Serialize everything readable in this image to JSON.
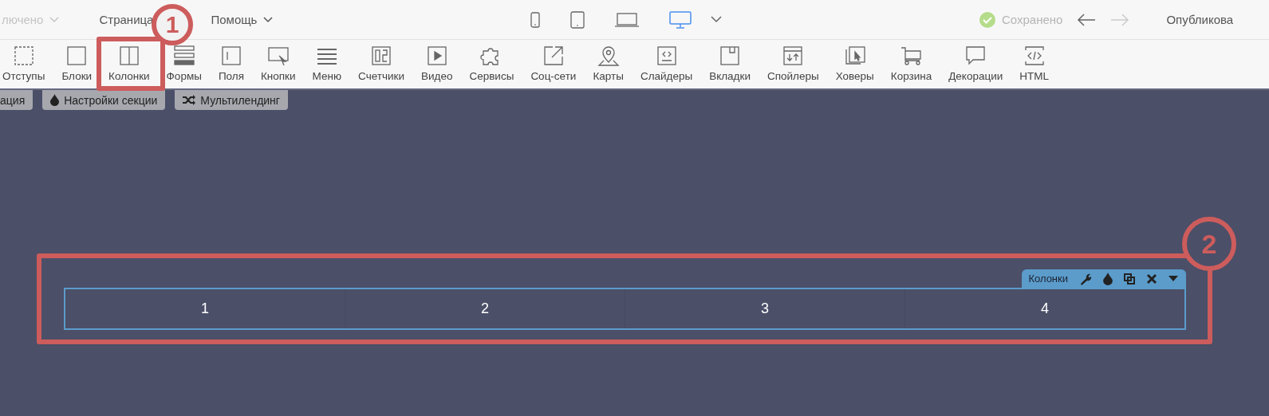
{
  "top_bar": {
    "status_menu": {
      "label": "лючено",
      "disabled": true
    },
    "menus": [
      {
        "label": "Страница"
      },
      {
        "label": "Помощь"
      }
    ],
    "devices": [
      {
        "kind": "phone",
        "selected": false
      },
      {
        "kind": "tablet",
        "selected": false
      },
      {
        "kind": "laptop",
        "selected": false
      },
      {
        "kind": "desktop",
        "selected": true
      }
    ],
    "save_status": "Сохранено",
    "undo_disabled": false,
    "redo_disabled": true,
    "publish": "Опубликова"
  },
  "toolbar": [
    {
      "label": "Отступы",
      "kind": "padding"
    },
    {
      "label": "Блоки",
      "kind": "block"
    },
    {
      "label": "Колонки",
      "kind": "columns"
    },
    {
      "label": "Формы",
      "kind": "forms"
    },
    {
      "label": "Поля",
      "kind": "field"
    },
    {
      "label": "Кнопки",
      "kind": "button"
    },
    {
      "label": "Меню",
      "kind": "menu"
    },
    {
      "label": "Счетчики",
      "kind": "counter"
    },
    {
      "label": "Видео",
      "kind": "video"
    },
    {
      "label": "Сервисы",
      "kind": "puzzle"
    },
    {
      "label": "Соц-сети",
      "kind": "share"
    },
    {
      "label": "Карты",
      "kind": "map"
    },
    {
      "label": "Слайдеры",
      "kind": "slider"
    },
    {
      "label": "Вкладки",
      "kind": "tabs"
    },
    {
      "label": "Спойлеры",
      "kind": "spoiler"
    },
    {
      "label": "Ховеры",
      "kind": "hover"
    },
    {
      "label": "Корзина",
      "kind": "cart"
    },
    {
      "label": "Декорации",
      "kind": "speech"
    },
    {
      "label": "HTML",
      "kind": "code"
    }
  ],
  "section_tabs": [
    {
      "label": "ация",
      "kind": "plain"
    },
    {
      "label": "Настройки секции",
      "kind": "drop"
    },
    {
      "label": "Мультилендинг",
      "kind": "shuffle"
    }
  ],
  "block": {
    "label": "Колонки",
    "columns": [
      "1",
      "2",
      "3",
      "4"
    ]
  },
  "annotations": [
    {
      "label": "1"
    },
    {
      "label": "2"
    }
  ]
}
